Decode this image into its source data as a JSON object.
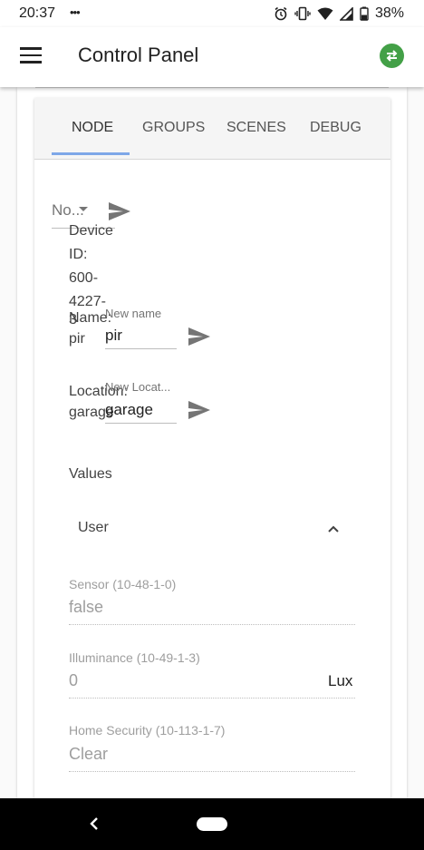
{
  "status_bar": {
    "time": "20:37",
    "dots": "•••",
    "battery": "38%"
  },
  "app_bar": {
    "title": "Control Panel"
  },
  "tabs": [
    {
      "label": "NODE"
    },
    {
      "label": "GROUPS"
    },
    {
      "label": "SCENES"
    },
    {
      "label": "DEBUG"
    }
  ],
  "node": {
    "select_value": "No...",
    "device_id_lines": [
      "Device",
      "ID:",
      "600-",
      "4227-",
      "3"
    ],
    "name": {
      "label_lines": [
        "Name:",
        "pir"
      ],
      "field_label": "New name",
      "value": "pir"
    },
    "location": {
      "label_lines": [
        "Location:",
        "garage"
      ],
      "field_label": "New Locat...",
      "value": "garage"
    }
  },
  "values_section": {
    "title": "Values",
    "group": "User",
    "items": [
      {
        "label": "Sensor (10-48-1-0)",
        "value": "false",
        "unit": ""
      },
      {
        "label": "Illuminance (10-49-1-3)",
        "value": "0",
        "unit": "Lux"
      },
      {
        "label": "Home Security (10-113-1-7)",
        "value": "Clear",
        "unit": ""
      }
    ]
  },
  "colors": {
    "accent_tab": "#7ea7e8",
    "sync_button": "#43a047"
  },
  "icons": [
    "alarm-icon",
    "vibrate-icon",
    "wifi-icon",
    "signal-icon",
    "battery-icon",
    "menu-icon",
    "sync-icon",
    "send-icon",
    "chevron-up-icon",
    "back-icon"
  ]
}
